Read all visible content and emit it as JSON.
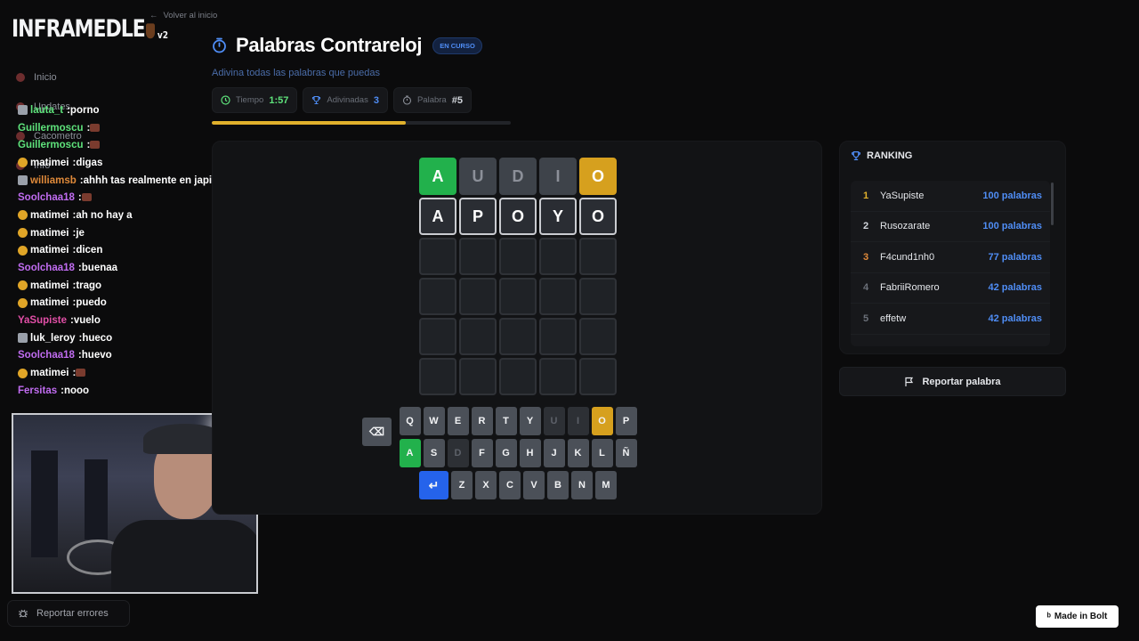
{
  "app": {
    "logo": "INFRAMEDLE",
    "logo_version": "v2"
  },
  "sidebar": {
    "items": [
      {
        "label": "Inicio"
      },
      {
        "label": "Updates"
      },
      {
        "label": "Cacometro"
      },
      {
        "label": "Info"
      }
    ]
  },
  "chat": [
    {
      "user": "lauta_t",
      "color": "#5ee27b",
      "badge": "pic",
      "text": "porno",
      "emote": false
    },
    {
      "user": "Guillermoscu",
      "color": "#5ee27b",
      "badge": "",
      "text": "",
      "emote": true
    },
    {
      "user": "Guillermoscu",
      "color": "#5ee27b",
      "badge": "",
      "text": "",
      "emote": true
    },
    {
      "user": "matimei",
      "color": "#ffffff",
      "badge": "gold",
      "text": "digas",
      "emote": false
    },
    {
      "user": "williamsb",
      "color": "#e08a3a",
      "badge": "pic",
      "text": "ahhh tas realmente en japi",
      "emote": false
    },
    {
      "user": "Soolchaa18",
      "color": "#c06cf0",
      "badge": "",
      "text": "",
      "emote": true
    },
    {
      "user": "matimei",
      "color": "#ffffff",
      "badge": "gold",
      "text": "ah no hay a",
      "emote": false
    },
    {
      "user": "matimei",
      "color": "#ffffff",
      "badge": "gold",
      "text": "je",
      "emote": false
    },
    {
      "user": "matimei",
      "color": "#ffffff",
      "badge": "gold",
      "text": "dicen",
      "emote": false
    },
    {
      "user": "Soolchaa18",
      "color": "#c06cf0",
      "badge": "",
      "text": "buenaa",
      "emote": false
    },
    {
      "user": "matimei",
      "color": "#ffffff",
      "badge": "gold",
      "text": "trago",
      "emote": false
    },
    {
      "user": "matimei",
      "color": "#ffffff",
      "badge": "gold",
      "text": "puedo",
      "emote": false
    },
    {
      "user": "YaSupiste",
      "color": "#e24fa7",
      "badge": "",
      "text": "vuelo",
      "emote": false
    },
    {
      "user": "luk_leroy",
      "color": "#ffffff",
      "badge": "pic",
      "text": "hueco",
      "emote": false
    },
    {
      "user": "Soolchaa18",
      "color": "#c06cf0",
      "badge": "",
      "text": "huevo",
      "emote": false
    },
    {
      "user": "matimei",
      "color": "#ffffff",
      "badge": "gold",
      "text": "",
      "emote": true
    },
    {
      "user": "Fersitas",
      "color": "#c06cf0",
      "badge": "",
      "text": "nooo",
      "emote": false
    }
  ],
  "report_errors_label": "Reportar errores",
  "back_label": "Volver al inicio",
  "title": "Palabras Contrareloj",
  "status_badge": "EN CURSO",
  "subtitle": "Adivina todas las palabras que puedas",
  "stats": [
    {
      "label": "Tiempo",
      "value": "1:57",
      "color": "#5ee27b",
      "icon": "clock-icon"
    },
    {
      "label": "Adivinadas",
      "value": "3",
      "color": "#4f8df5",
      "icon": "trophy-icon"
    },
    {
      "label": "Palabra",
      "value": "#5",
      "color": "#d1d5db",
      "icon": "timer-icon"
    }
  ],
  "progress": 0.65,
  "board": [
    [
      {
        "l": "A",
        "s": "green"
      },
      {
        "l": "U",
        "s": "gray"
      },
      {
        "l": "D",
        "s": "gray"
      },
      {
        "l": "I",
        "s": "gray"
      },
      {
        "l": "O",
        "s": "yellow"
      }
    ],
    [
      {
        "l": "A",
        "s": "typed"
      },
      {
        "l": "P",
        "s": "typed"
      },
      {
        "l": "O",
        "s": "typed"
      },
      {
        "l": "Y",
        "s": "typed"
      },
      {
        "l": "O",
        "s": "typed"
      }
    ],
    [
      {
        "l": "",
        "s": ""
      },
      {
        "l": "",
        "s": ""
      },
      {
        "l": "",
        "s": ""
      },
      {
        "l": "",
        "s": ""
      },
      {
        "l": "",
        "s": ""
      }
    ],
    [
      {
        "l": "",
        "s": ""
      },
      {
        "l": "",
        "s": ""
      },
      {
        "l": "",
        "s": ""
      },
      {
        "l": "",
        "s": ""
      },
      {
        "l": "",
        "s": ""
      }
    ],
    [
      {
        "l": "",
        "s": ""
      },
      {
        "l": "",
        "s": ""
      },
      {
        "l": "",
        "s": ""
      },
      {
        "l": "",
        "s": ""
      },
      {
        "l": "",
        "s": ""
      }
    ],
    [
      {
        "l": "",
        "s": ""
      },
      {
        "l": "",
        "s": ""
      },
      {
        "l": "",
        "s": ""
      },
      {
        "l": "",
        "s": ""
      },
      {
        "l": "",
        "s": ""
      }
    ]
  ],
  "keyboard": [
    [
      {
        "k": "Q"
      },
      {
        "k": "W"
      },
      {
        "k": "E"
      },
      {
        "k": "R"
      },
      {
        "k": "T"
      },
      {
        "k": "Y"
      },
      {
        "k": "U",
        "s": "used"
      },
      {
        "k": "I",
        "s": "used"
      },
      {
        "k": "O",
        "s": "yellow"
      },
      {
        "k": "P"
      }
    ],
    [
      {
        "k": "A",
        "s": "green"
      },
      {
        "k": "S"
      },
      {
        "k": "D",
        "s": "used"
      },
      {
        "k": "F"
      },
      {
        "k": "G"
      },
      {
        "k": "H"
      },
      {
        "k": "J"
      },
      {
        "k": "K"
      },
      {
        "k": "L"
      },
      {
        "k": "Ñ"
      }
    ],
    [
      {
        "k": "↵",
        "s": "enter"
      },
      {
        "k": "Z"
      },
      {
        "k": "X"
      },
      {
        "k": "C"
      },
      {
        "k": "V"
      },
      {
        "k": "B"
      },
      {
        "k": "N"
      },
      {
        "k": "M"
      },
      {
        "k": "⌫",
        "s": "back"
      }
    ]
  ],
  "ranking": {
    "title": "RANKING",
    "rows": [
      {
        "pos": "1",
        "name": "YaSupiste",
        "pts": "100 palabras",
        "pos_color": "#e1b12c"
      },
      {
        "pos": "2",
        "name": "Rusozarate",
        "pts": "100 palabras",
        "pos_color": "#d1d5db"
      },
      {
        "pos": "3",
        "name": "F4cund1nh0",
        "pts": "77 palabras",
        "pos_color": "#e08a3a"
      },
      {
        "pos": "4",
        "name": "FabriiRomero",
        "pts": "42 palabras",
        "pos_color": "#6b7079"
      },
      {
        "pos": "5",
        "name": "effetw",
        "pts": "42 palabras",
        "pos_color": "#6b7079"
      }
    ]
  },
  "report_word_label": "Reportar palabra",
  "bolt_label": "Made in Bolt"
}
